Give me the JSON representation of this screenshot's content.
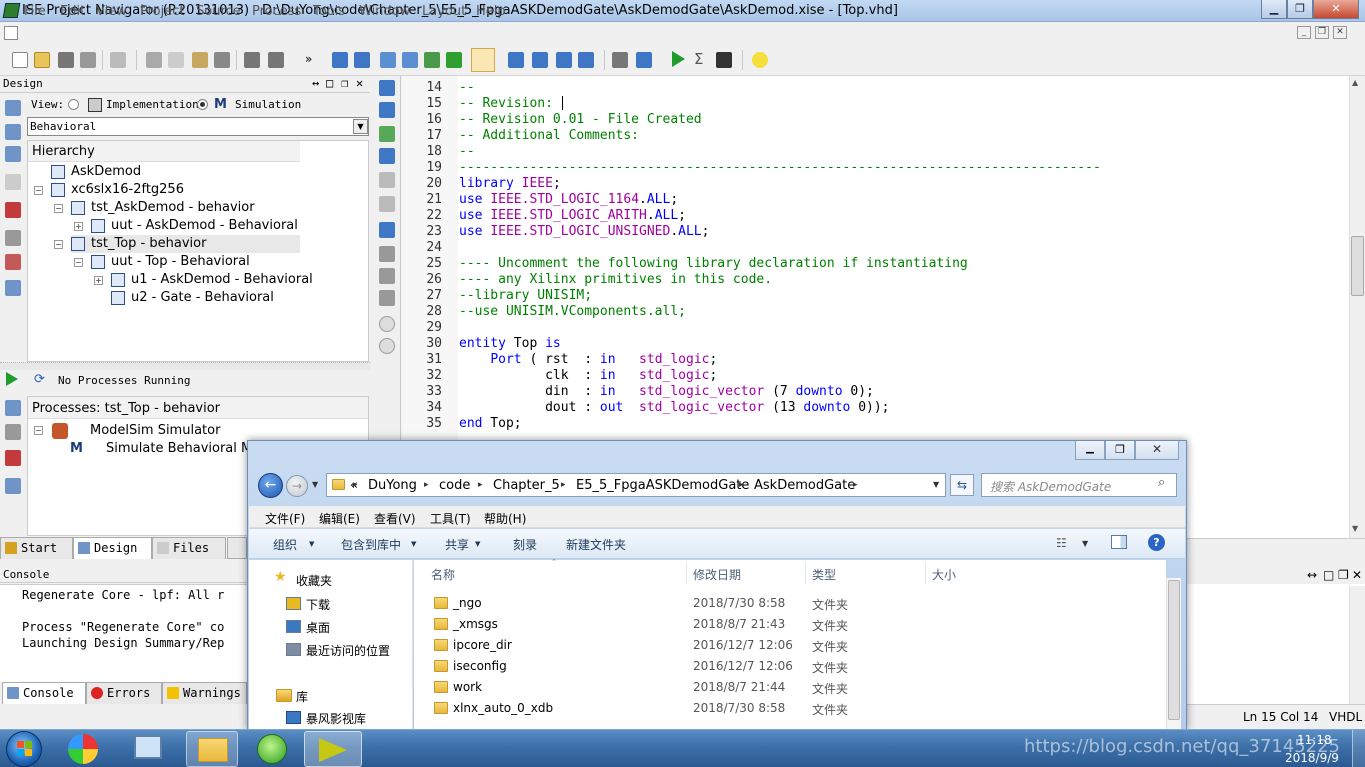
{
  "window": {
    "title": "ISE Project Navigator (P.20131013) - D:\\DuYong\\code\\Chapter_5\\E5_5_FpgaASKDemodGate\\AskDemodGate\\AskDemod.xise - [Top.vhd]",
    "minimize_glyph": "▁",
    "maximize_glyph": "❐",
    "close_glyph": "✕"
  },
  "menubar": [
    "File",
    "Edit",
    "View",
    "Project",
    "Source",
    "Process",
    "Tools",
    "Window",
    "Layout",
    "Help"
  ],
  "design_panel": {
    "title": "Design",
    "view_label": "View:",
    "implementation_label": "Implementation",
    "simulation_label": "Simulation",
    "selected_view": "Simulation",
    "filter_value": "Behavioral",
    "hierarchy_header": "Hierarchy",
    "tree": [
      {
        "label": "AskDemod",
        "depth": 0,
        "expander": ""
      },
      {
        "label": "xc6slx16-2ftg256",
        "depth": 0,
        "expander": "−"
      },
      {
        "label": "tst_AskDemod - behavior",
        "depth": 1,
        "expander": "−"
      },
      {
        "label": "uut - AskDemod - Behavioral",
        "depth": 2,
        "expander": "+"
      },
      {
        "label": "tst_Top - behavior",
        "depth": 1,
        "expander": "−",
        "selected": true
      },
      {
        "label": "uut - Top - Behavioral",
        "depth": 2,
        "expander": "−"
      },
      {
        "label": "u1 - AskDemod - Behavioral",
        "depth": 3,
        "expander": "+"
      },
      {
        "label": "u2 - Gate - Behavioral",
        "depth": 3,
        "expander": ""
      }
    ]
  },
  "process_panel": {
    "status": "No Processes Running",
    "header": "Processes: tst_Top - behavior",
    "items": [
      {
        "label": "ModelSim Simulator",
        "depth": 0
      },
      {
        "label": "Simulate Behavioral Model",
        "depth": 1
      }
    ]
  },
  "bottom_left_tabs": [
    "Start",
    "Design",
    "Files"
  ],
  "console": {
    "title": "Console",
    "lines": [
      "Regenerate Core - lpf: All r",
      "",
      "Process \"Regenerate Core\" co",
      "Launching Design Summary/Rep"
    ],
    "tabs": [
      "Console",
      "Errors",
      "Warnings"
    ]
  },
  "editor": {
    "lines": [
      {
        "n": "14",
        "parts": [
          {
            "c": "cm",
            "t": "--"
          }
        ]
      },
      {
        "n": "15",
        "parts": [
          {
            "c": "cm",
            "t": "-- Revision: "
          }
        ]
      },
      {
        "n": "16",
        "parts": [
          {
            "c": "cm",
            "t": "-- Revision 0.01 - File Created"
          }
        ]
      },
      {
        "n": "17",
        "parts": [
          {
            "c": "cm",
            "t": "-- Additional Comments:"
          }
        ]
      },
      {
        "n": "18",
        "parts": [
          {
            "c": "cm",
            "t": "--"
          }
        ]
      },
      {
        "n": "19",
        "parts": [
          {
            "c": "cm",
            "t": "----------------------------------------------------------------------------------"
          }
        ]
      },
      {
        "n": "20",
        "parts": [
          {
            "c": "kw",
            "t": "library"
          },
          {
            "c": "nm",
            "t": " "
          },
          {
            "c": "ty",
            "t": "IEEE"
          },
          {
            "c": "nm",
            "t": ";"
          }
        ]
      },
      {
        "n": "21",
        "parts": [
          {
            "c": "kw",
            "t": "use"
          },
          {
            "c": "nm",
            "t": " "
          },
          {
            "c": "ty",
            "t": "IEEE.STD_LOGIC_1164"
          },
          {
            "c": "nm",
            "t": "."
          },
          {
            "c": "kw",
            "t": "ALL"
          },
          {
            "c": "nm",
            "t": ";"
          }
        ]
      },
      {
        "n": "22",
        "parts": [
          {
            "c": "kw",
            "t": "use"
          },
          {
            "c": "nm",
            "t": " "
          },
          {
            "c": "ty",
            "t": "IEEE.STD_LOGIC_ARITH"
          },
          {
            "c": "nm",
            "t": "."
          },
          {
            "c": "kw",
            "t": "ALL"
          },
          {
            "c": "nm",
            "t": ";"
          }
        ]
      },
      {
        "n": "23",
        "parts": [
          {
            "c": "kw",
            "t": "use"
          },
          {
            "c": "nm",
            "t": " "
          },
          {
            "c": "ty",
            "t": "IEEE.STD_LOGIC_UNSIGNED"
          },
          {
            "c": "nm",
            "t": "."
          },
          {
            "c": "kw",
            "t": "ALL"
          },
          {
            "c": "nm",
            "t": ";"
          }
        ]
      },
      {
        "n": "24",
        "parts": []
      },
      {
        "n": "25",
        "parts": [
          {
            "c": "cm",
            "t": "---- Uncomment the following library declaration if instantiating"
          }
        ]
      },
      {
        "n": "26",
        "parts": [
          {
            "c": "cm",
            "t": "---- any Xilinx primitives in this code."
          }
        ]
      },
      {
        "n": "27",
        "parts": [
          {
            "c": "cm",
            "t": "--library UNISIM;"
          }
        ]
      },
      {
        "n": "28",
        "parts": [
          {
            "c": "cm",
            "t": "--use UNISIM.VComponents.all;"
          }
        ]
      },
      {
        "n": "29",
        "parts": []
      },
      {
        "n": "30",
        "parts": [
          {
            "c": "kw",
            "t": "entity"
          },
          {
            "c": "nm",
            "t": " Top "
          },
          {
            "c": "kw",
            "t": "is"
          }
        ]
      },
      {
        "n": "31",
        "parts": [
          {
            "c": "nm",
            "t": "    "
          },
          {
            "c": "kw",
            "t": "Port"
          },
          {
            "c": "nm",
            "t": " ( rst  : "
          },
          {
            "c": "kw",
            "t": "in"
          },
          {
            "c": "nm",
            "t": "   "
          },
          {
            "c": "ty",
            "t": "std_logic"
          },
          {
            "c": "nm",
            "t": ";"
          }
        ]
      },
      {
        "n": "32",
        "parts": [
          {
            "c": "nm",
            "t": "           clk  : "
          },
          {
            "c": "kw",
            "t": "in"
          },
          {
            "c": "nm",
            "t": "   "
          },
          {
            "c": "ty",
            "t": "std_logic"
          },
          {
            "c": "nm",
            "t": ";"
          }
        ]
      },
      {
        "n": "33",
        "parts": [
          {
            "c": "nm",
            "t": "           din  : "
          },
          {
            "c": "kw",
            "t": "in"
          },
          {
            "c": "nm",
            "t": "   "
          },
          {
            "c": "ty",
            "t": "std_logic_vector"
          },
          {
            "c": "nm",
            "t": " (7 "
          },
          {
            "c": "kw",
            "t": "downto"
          },
          {
            "c": "nm",
            "t": " 0);"
          }
        ]
      },
      {
        "n": "34",
        "parts": [
          {
            "c": "nm",
            "t": "           dout : "
          },
          {
            "c": "kw",
            "t": "out"
          },
          {
            "c": "nm",
            "t": "  "
          },
          {
            "c": "ty",
            "t": "std_logic_vector"
          },
          {
            "c": "nm",
            "t": " (13 "
          },
          {
            "c": "kw",
            "t": "downto"
          },
          {
            "c": "nm",
            "t": " 0));"
          }
        ]
      },
      {
        "n": "35",
        "parts": [
          {
            "c": "kw",
            "t": "end"
          },
          {
            "c": "nm",
            "t": " Top;"
          }
        ]
      }
    ]
  },
  "status_bar": {
    "position": "Ln 15 Col 14",
    "language": "VHDL"
  },
  "explorer": {
    "breadcrumb": [
      "«",
      "DuYong",
      "code",
      "Chapter_5",
      "E5_5_FpgaASKDemodGate",
      "AskDemodGate"
    ],
    "search_placeholder": "搜索 AskDemodGate",
    "menus": [
      "文件(F)",
      "编辑(E)",
      "查看(V)",
      "工具(T)",
      "帮助(H)"
    ],
    "commands": [
      "组织",
      "包含到库中",
      "共享",
      "刻录",
      "新建文件夹"
    ],
    "nav": {
      "favorites": "收藏夹",
      "favorite_items": [
        "下载",
        "桌面",
        "最近访问的位置"
      ],
      "libraries": "库",
      "library_items": [
        "暴风影视库"
      ]
    },
    "columns": [
      "名称",
      "修改日期",
      "类型",
      "大小"
    ],
    "files": [
      {
        "name": "_ngo",
        "date": "2018/7/30 8:58",
        "type": "文件夹"
      },
      {
        "name": "_xmsgs",
        "date": "2018/8/7 21:43",
        "type": "文件夹"
      },
      {
        "name": "ipcore_dir",
        "date": "2016/12/7 12:06",
        "type": "文件夹"
      },
      {
        "name": "iseconfig",
        "date": "2016/12/7 12:06",
        "type": "文件夹"
      },
      {
        "name": "work",
        "date": "2018/8/7 21:44",
        "type": "文件夹"
      },
      {
        "name": "xlnx_auto_0_xdb",
        "date": "2018/7/30 8:58",
        "type": "文件夹"
      }
    ]
  },
  "taskbar": {
    "time": "11:18",
    "date": "2018/9/9"
  },
  "watermark": "https://blog.csdn.net/qq_37145225",
  "colors": {
    "comment": "#008000",
    "keyword": "#0000ff",
    "type": "#a000a0",
    "taskbar": "#3d6fa8"
  }
}
